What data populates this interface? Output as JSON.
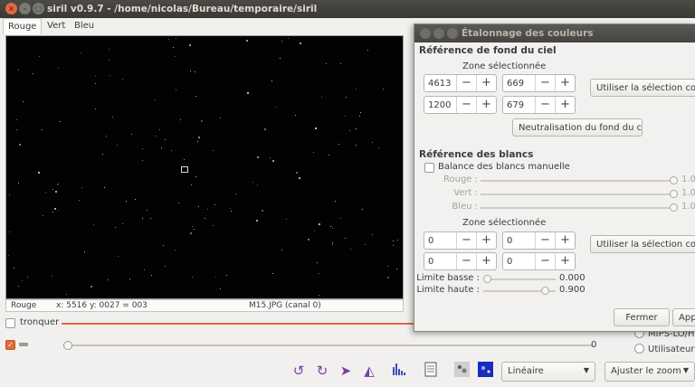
{
  "window": {
    "title": "siril v0.9.7 - /home/nicolas/Bureau/temporaire/siril",
    "close_glyph": "×",
    "min_glyph": "–",
    "max_glyph": "□"
  },
  "tabs": [
    {
      "label": "Rouge",
      "active": true
    },
    {
      "label": "Vert",
      "active": false
    },
    {
      "label": "Bleu",
      "active": false
    }
  ],
  "status": {
    "channel": "Rouge",
    "coords": "x: 5516 y: 0027 = 003",
    "filename": "M15.JPG (canal 0)"
  },
  "crop": {
    "label": "tronquer",
    "checked": false
  },
  "slider2": {
    "checked": true,
    "value": "0",
    "position": 0.0
  },
  "radios": [
    {
      "label": "MIPS-LO/HI",
      "selected": false
    },
    {
      "label": "Utilisateur",
      "selected": false
    }
  ],
  "toolbar": {
    "icons": [
      "rotate-left-icon",
      "rotate-right-icon",
      "mirror-x-icon",
      "mirror-y-icon",
      "histogram-icon",
      "document-icon",
      "image-negative-icon",
      "colormap-icon"
    ],
    "scale_mode": "Linéaire",
    "zoom_mode": "Ajuster le zoom"
  },
  "dialog": {
    "title": "Étalonnage des couleurs",
    "background_ref": {
      "heading": "Référence de fond du ciel",
      "zone_label": "Zone sélectionnée",
      "x": "4613",
      "y": "669",
      "w": "1200",
      "h": "679",
      "use_selection": "Utiliser la sélection courante",
      "neutralize": "Neutralisation du fond du ciel"
    },
    "white_ref": {
      "heading": "Référence des blancs",
      "manual_label": "Balance des blancs manuelle",
      "manual_checked": false,
      "channels": [
        {
          "label": "Rouge :",
          "value": "1.0",
          "level": 1.0
        },
        {
          "label": "Vert :",
          "value": "1.0",
          "level": 1.0
        },
        {
          "label": "Bleu :",
          "value": "1.0",
          "level": 1.0
        }
      ],
      "zone_label": "Zone sélectionnée",
      "x": "0",
      "y": "0",
      "w": "0",
      "h": "0",
      "use_selection": "Utiliser la sélection courante",
      "low_limit_label": "Limite basse :",
      "low_limit_value": "0.000",
      "low_limit_level": 0.0,
      "high_limit_label": "Limite haute :",
      "high_limit_value": "0.900",
      "high_limit_level": 0.9
    },
    "close_label": "Fermer",
    "apply_label": "Appliquer"
  },
  "colors": {
    "accent": "#e06a3a",
    "titlebar": "#3c3b37",
    "icon_purple": "#7b3fa8"
  }
}
